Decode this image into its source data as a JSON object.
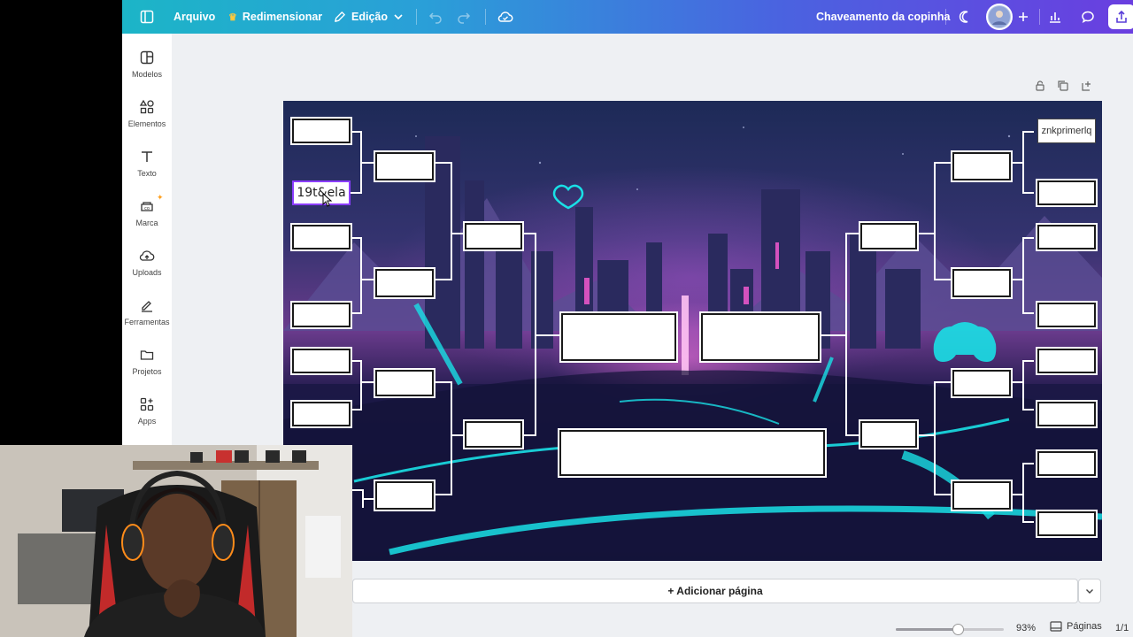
{
  "topbar": {
    "file_label": "Arquivo",
    "resize_label": "Redimensionar",
    "edit_label": "Edição",
    "doc_title": "Chaveamento da copinha"
  },
  "sidebar": {
    "items": [
      {
        "label": "Modelos",
        "icon": "template-icon"
      },
      {
        "label": "Elementos",
        "icon": "elements-icon"
      },
      {
        "label": "Texto",
        "icon": "text-icon"
      },
      {
        "label": "Marca",
        "icon": "brand-icon"
      },
      {
        "label": "Uploads",
        "icon": "upload-icon"
      },
      {
        "label": "Ferramentas",
        "icon": "tools-icon"
      },
      {
        "label": "Projetos",
        "icon": "folder-icon"
      },
      {
        "label": "Apps",
        "icon": "apps-icon"
      }
    ]
  },
  "bracket": {
    "left_slot_2_text": "19t&ela",
    "right_slot_1_text": "znkprimerlq"
  },
  "bottom": {
    "add_page_label": "+ Adicionar página",
    "zoom_label": "93%",
    "zoom_fraction": 0.57,
    "pages_label": "Páginas",
    "page_count": "1/1"
  },
  "colors": {
    "accent": "#8b3dff",
    "topbar_start": "#1cb5c7",
    "topbar_end": "#6a3ee0",
    "neon_cyan": "#19e0e6"
  }
}
